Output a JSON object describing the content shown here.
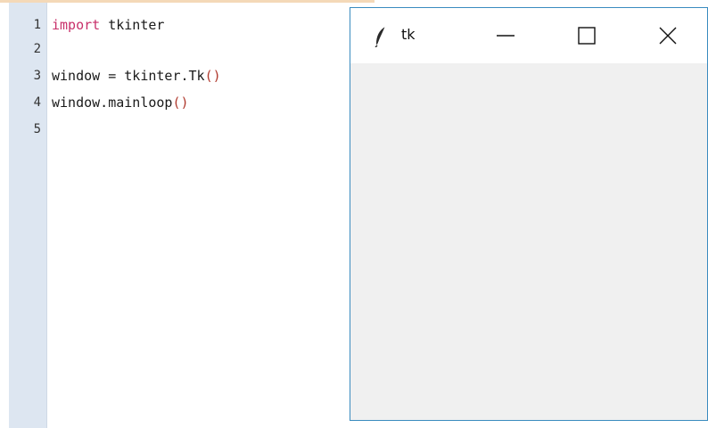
{
  "editor": {
    "line_numbers": [
      "1",
      "2",
      "3",
      "4",
      "5"
    ],
    "lines": [
      {
        "keyword": "import",
        "rest": " tkinter"
      },
      {
        "text": ""
      },
      {
        "pre": "window = tkinter.Tk",
        "paren": "()"
      },
      {
        "pre": "window.mainloop",
        "paren": "()"
      },
      {
        "text": ""
      }
    ]
  },
  "tk_window": {
    "title": "tk",
    "icon": "feather-icon",
    "controls": [
      "minimize-icon",
      "maximize-icon",
      "close-icon"
    ]
  },
  "colors": {
    "keyword": "#c8306a",
    "paren": "#b03a2e",
    "gutter": "#dde6f1",
    "window_border": "#3a8bbf",
    "window_client": "#f0f0f0"
  }
}
